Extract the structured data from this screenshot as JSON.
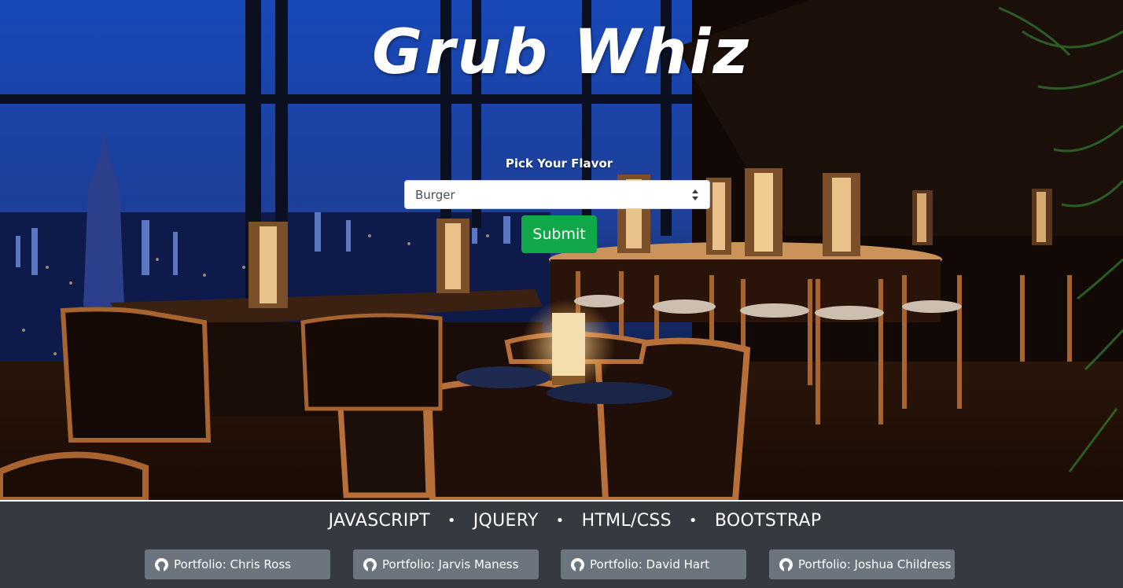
{
  "app": {
    "title": "Grub Whiz"
  },
  "form": {
    "label": "Pick Your Flavor",
    "selected": "Burger",
    "submit_label": "Submit"
  },
  "footer": {
    "technologies": [
      "JAVASCRIPT",
      "JQUERY",
      "HTML/CSS",
      "BOOTSTRAP"
    ],
    "separator": "•",
    "portfolios": [
      {
        "label": "Portfolio: Chris Ross",
        "icon": "github-icon"
      },
      {
        "label": "Portfolio: Jarvis Maness",
        "icon": "github-icon"
      },
      {
        "label": "Portfolio: David Hart",
        "icon": "github-icon"
      },
      {
        "label": "Portfolio: Joshua Childress",
        "icon": "github-icon"
      }
    ]
  },
  "colors": {
    "submit": "#11a84a",
    "footer_bg": "#343a40",
    "portfolio_button": "#6c757d"
  }
}
